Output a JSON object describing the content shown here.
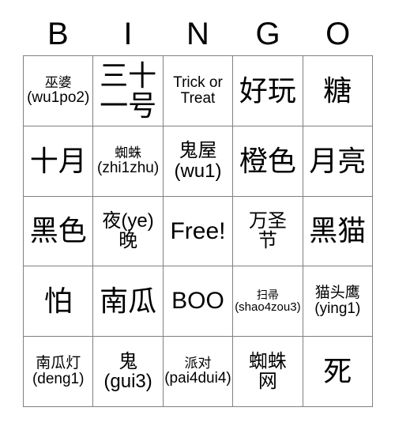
{
  "header": {
    "letters": [
      "B",
      "I",
      "N",
      "G",
      "O"
    ]
  },
  "grid": {
    "rows": [
      [
        {
          "main": "巫婆",
          "sub": "(wu1po2)",
          "style": "two-small"
        },
        {
          "main": "三十",
          "sub": "一号",
          "style": "two-big"
        },
        {
          "main": "Trick or",
          "sub": "Treat",
          "style": "two-latin"
        },
        {
          "main": "好玩",
          "sub": "",
          "style": "one-big"
        },
        {
          "main": "糖",
          "sub": "",
          "style": "one-big"
        }
      ],
      [
        {
          "main": "十月",
          "sub": "",
          "style": "one-big"
        },
        {
          "main": "蜘蛛",
          "sub": "(zhi1zhu)",
          "style": "two-small"
        },
        {
          "main": "鬼屋",
          "sub": "(wu1)",
          "style": "two-med"
        },
        {
          "main": "橙色",
          "sub": "",
          "style": "one-big"
        },
        {
          "main": "月亮",
          "sub": "",
          "style": "one-big"
        }
      ],
      [
        {
          "main": "黑色",
          "sub": "",
          "style": "one-big"
        },
        {
          "main": "夜(ye)",
          "sub": "晚",
          "style": "two-med"
        },
        {
          "main": "Free!",
          "sub": "",
          "style": "one-free"
        },
        {
          "main": "万圣",
          "sub": "节",
          "style": "two-med"
        },
        {
          "main": "黑猫",
          "sub": "",
          "style": "one-big"
        }
      ],
      [
        {
          "main": "怕",
          "sub": "",
          "style": "one-big"
        },
        {
          "main": "南瓜",
          "sub": "",
          "style": "one-big"
        },
        {
          "main": "BOO",
          "sub": "",
          "style": "one-boo"
        },
        {
          "main": "扫帚",
          "sub": "(shao4zou3)",
          "style": "two-tiny"
        },
        {
          "main": "猫头鹰",
          "sub": "(ying1)",
          "style": "two-med3"
        }
      ],
      [
        {
          "main": "南瓜灯",
          "sub": "(deng1)",
          "style": "two-small3"
        },
        {
          "main": "鬼",
          "sub": "(gui3)",
          "style": "two-med"
        },
        {
          "main": "派对",
          "sub": "(pai4dui4)",
          "style": "two-small"
        },
        {
          "main": "蜘蛛",
          "sub": "网",
          "style": "two-med"
        },
        {
          "main": "死",
          "sub": "",
          "style": "one-big"
        }
      ]
    ]
  },
  "colors": {
    "grid_line": "#808080",
    "text": "#000000",
    "background": "#ffffff"
  }
}
